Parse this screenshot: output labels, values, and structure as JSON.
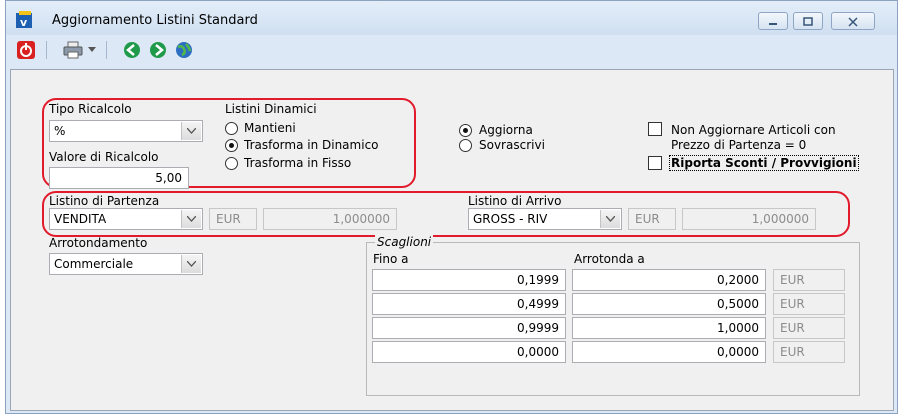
{
  "window": {
    "title": "Aggiornamento Listini Standard",
    "icon": "app-icon",
    "controls": {
      "minimize": "minimize-icon",
      "maximize": "maximize-icon",
      "close": "close-icon"
    }
  },
  "toolbar": {
    "icons": [
      "power-icon",
      "printer-icon",
      "dropdown-arrow-icon",
      "back-icon",
      "forward-icon",
      "globe-icon"
    ]
  },
  "tipo_ricalcolo": {
    "label": "Tipo Ricalcolo",
    "value": "%"
  },
  "valore_ricalcolo": {
    "label": "Valore di Ricalcolo",
    "value": "5,00"
  },
  "listini_dinamici": {
    "label": "Listini Dinamici",
    "options": [
      {
        "label": "Mantieni",
        "selected": false
      },
      {
        "label": "Trasforma in Dinamico",
        "selected": true
      },
      {
        "label": "Trasforma in Fisso",
        "selected": false
      }
    ]
  },
  "modalita": {
    "options": [
      {
        "label": "Aggiorna",
        "selected": true
      },
      {
        "label": "Sovrascrivi",
        "selected": false
      }
    ]
  },
  "opzioni": {
    "non_aggiornare_line1": "Non Aggiornare Articoli con",
    "non_aggiornare_line2": "Prezzo di Partenza = 0",
    "non_aggiornare_checked": false,
    "riporta_sconti": "Riporta Sconti / Provvigioni",
    "riporta_sconti_checked": false
  },
  "listino_partenza": {
    "label": "Listino di Partenza",
    "value": "VENDITA",
    "currency": "EUR",
    "rate": "1,000000"
  },
  "listino_arrivo": {
    "label": "Listino di Arrivo",
    "value": "GROSS - RIV",
    "currency": "EUR",
    "rate": "1,000000"
  },
  "arrotondamento": {
    "label": "Arrotondamento",
    "value": "Commerciale"
  },
  "scaglioni": {
    "label": "Scaglioni",
    "col_fino": "Fino a",
    "col_arrotonda": "Arrotonda a",
    "rows": [
      {
        "fino": "0,1999",
        "arrotonda": "0,2000",
        "currency": "EUR"
      },
      {
        "fino": "0,4999",
        "arrotonda": "0,5000",
        "currency": "EUR"
      },
      {
        "fino": "0,9999",
        "arrotonda": "1,0000",
        "currency": "EUR"
      },
      {
        "fino": "0,0000",
        "arrotonda": "0,0000",
        "currency": "EUR"
      }
    ]
  },
  "colors": {
    "highlight": "#e11b2b",
    "title_bar": "#cfdff1",
    "panel": "#f0f0f0"
  }
}
